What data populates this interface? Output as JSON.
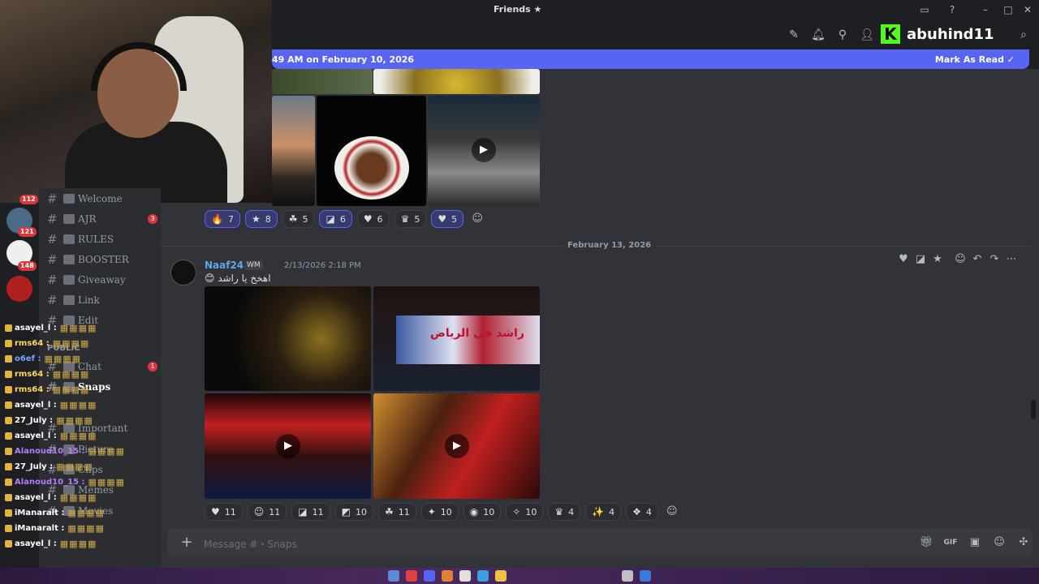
{
  "window": {
    "title": "Friends ★"
  },
  "toolbar": {
    "brand_name": "abuhind11"
  },
  "new_messages": {
    "text": "49 AM on February 10, 2026",
    "mark_read": "Mark As Read"
  },
  "rail_badges": [
    "112",
    "121",
    "148"
  ],
  "channels": [
    {
      "label": "Welcome",
      "badge": ""
    },
    {
      "label": "AJR",
      "badge": "3"
    },
    {
      "label": "RULES",
      "badge": ""
    },
    {
      "label": "BOOSTER",
      "badge": ""
    },
    {
      "label": "Giveaway",
      "badge": ""
    },
    {
      "label": "Link",
      "badge": ""
    },
    {
      "label": "Edit",
      "badge": ""
    },
    {
      "label": "Chat",
      "badge": "1"
    },
    {
      "label": "Snaps",
      "badge": ""
    },
    {
      "label": "Important",
      "badge": ""
    },
    {
      "label": "Picture",
      "badge": ""
    },
    {
      "label": "Clips",
      "badge": ""
    },
    {
      "label": "Memes",
      "badge": ""
    },
    {
      "label": "Movies",
      "badge": ""
    }
  ],
  "category": "PUBLIC",
  "stream_chat": [
    {
      "user": "asayel_l :",
      "color": "#ffffff"
    },
    {
      "user": "rms64 :",
      "color": "#ffd75e"
    },
    {
      "user": "o6ef :",
      "color": "#6fa8ff"
    },
    {
      "user": "rms64 :",
      "color": "#ffd75e"
    },
    {
      "user": "rms64 :",
      "color": "#ffd75e"
    },
    {
      "user": "asayel_l :",
      "color": "#ffffff"
    },
    {
      "user": "27_July :",
      "color": "#ffffff"
    },
    {
      "user": "asayel_l :",
      "color": "#ffffff"
    },
    {
      "user": "Alanoud10_15 :",
      "color": "#b57bff"
    },
    {
      "user": "27_July :",
      "color": "#ffffff"
    },
    {
      "user": "Alanoud10_15 :",
      "color": "#b57bff"
    },
    {
      "user": "asayel_l :",
      "color": "#ffffff"
    },
    {
      "user": "iManaralt :",
      "color": "#ffffff"
    },
    {
      "user": "iManaralt :",
      "color": "#ffffff"
    },
    {
      "user": "asayel_l :",
      "color": "#ffffff"
    }
  ],
  "reactions_top": [
    {
      "glyph": "🔥",
      "count": "7",
      "selected": true
    },
    {
      "glyph": "★",
      "count": "8",
      "selected": true
    },
    {
      "glyph": "☘",
      "count": "5",
      "selected": false
    },
    {
      "glyph": "◪",
      "count": "6",
      "selected": true
    },
    {
      "glyph": "♥",
      "count": "6",
      "selected": false
    },
    {
      "glyph": "♛",
      "count": "5",
      "selected": false
    },
    {
      "glyph": "♥",
      "count": "5",
      "selected": true
    }
  ],
  "date_divider": "February 13, 2026",
  "message": {
    "author": "Naaf24",
    "tag": "WM",
    "timestamp": "2/13/2026 2:18 PM",
    "text": "اهخخ يا راشد"
  },
  "reactions_bottom": [
    {
      "glyph": "♥",
      "count": "11"
    },
    {
      "glyph": "☺",
      "count": "11"
    },
    {
      "glyph": "◪",
      "count": "11"
    },
    {
      "glyph": "◩",
      "count": "10"
    },
    {
      "glyph": "☘",
      "count": "11"
    },
    {
      "glyph": "✦",
      "count": "10"
    },
    {
      "glyph": "◉",
      "count": "10"
    },
    {
      "glyph": "✧",
      "count": "10"
    },
    {
      "glyph": "♛",
      "count": "4"
    },
    {
      "glyph": "✨",
      "count": "4"
    },
    {
      "glyph": "❖",
      "count": "4"
    }
  ],
  "composer": {
    "placeholder": "Message #・Snaps"
  },
  "image_overlay_text": "راشد في الرياض"
}
